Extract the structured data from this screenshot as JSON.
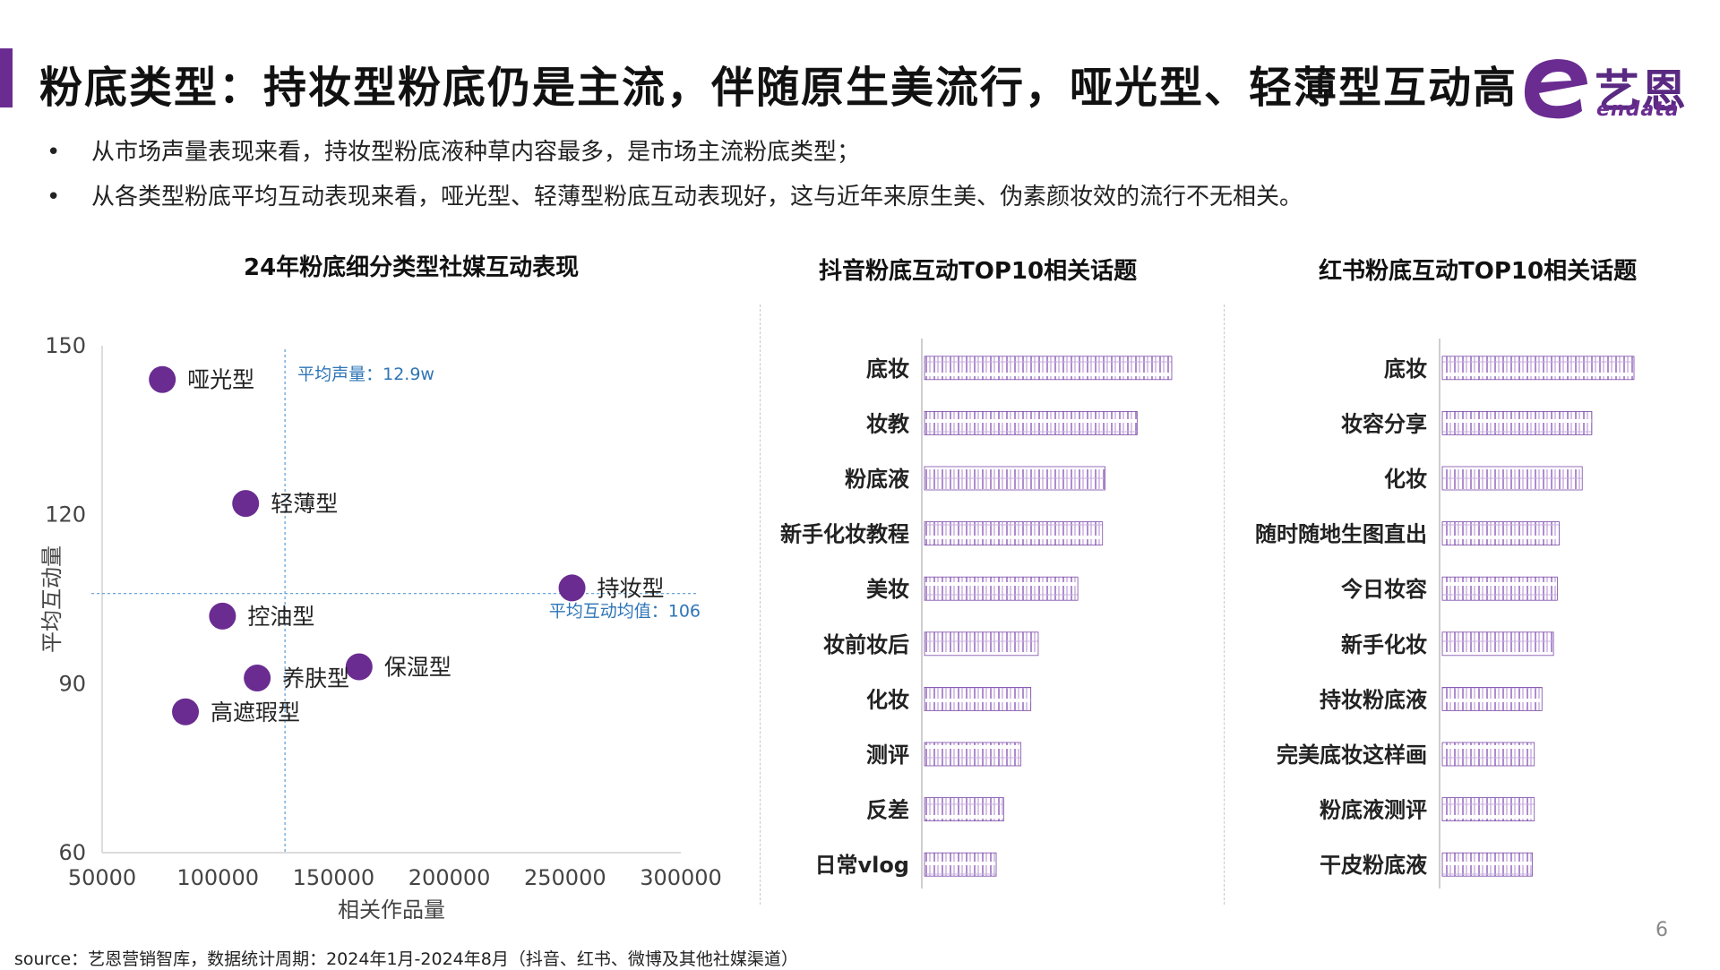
{
  "header": {
    "title": "粉底类型：持妆型粉底仍是主流，伴随原生美流行，哑光型、轻薄型互动高",
    "logo_cn": "艺恩",
    "logo_en": "endata"
  },
  "bullets": [
    {
      "marker": "•",
      "text": "从市场声量表现来看，持妆型粉底液种草内容最多，是市场主流粉底类型；"
    },
    {
      "marker": "•",
      "text": "从各类型粉底平均互动表现来看，哑光型、轻薄型粉底互动表现好，这与近年来原生美、伪素颜妆效的流行不无相关。"
    }
  ],
  "footer": {
    "source": "source：艺恩营销智库，数据统计周期：2024年1月-2024年8月（抖音、红书、微博及其他社媒渠道）",
    "page": "6"
  },
  "colors": {
    "accent": "#6a2c91",
    "point": "#6a2c91",
    "guide": "#5b9bd5",
    "guide_text": "#2e75b6",
    "bar_stroke": "#7a4aa6"
  },
  "chart_data": [
    {
      "type": "scatter",
      "title": "24年粉底细分类型社媒互动表现",
      "xlabel": "相关作品量",
      "ylabel": "平均互动量",
      "xlim": [
        50000,
        300000
      ],
      "ylim": [
        60,
        150
      ],
      "xticks": [
        "50000",
        "100000",
        "150000",
        "200000",
        "250000",
        "300000"
      ],
      "yticks": [
        "60",
        "90",
        "120",
        "150"
      ],
      "points": [
        {
          "label": "哑光型",
          "x": 76000,
          "y": 144
        },
        {
          "label": "轻薄型",
          "x": 112000,
          "y": 122
        },
        {
          "label": "持妆型",
          "x": 253000,
          "y": 107
        },
        {
          "label": "控油型",
          "x": 102000,
          "y": 102
        },
        {
          "label": "保湿型",
          "x": 161000,
          "y": 93
        },
        {
          "label": "养肤型",
          "x": 117000,
          "y": 91
        },
        {
          "label": "高遮瑕型",
          "x": 86000,
          "y": 85
        }
      ],
      "vline": {
        "x": 129000,
        "label": "平均声量：12.9w"
      },
      "hline": {
        "y": 106,
        "label": "平均互动均值：106"
      }
    },
    {
      "type": "bar",
      "title": "抖音粉底互动TOP10相关话题",
      "categories": [
        "底妆",
        "妆教",
        "粉底液",
        "新手化妆教程",
        "美妆",
        "妆前妆后",
        "化妆",
        "测评",
        "反差",
        "日常vlog"
      ],
      "values": [
        100,
        86,
        73,
        72,
        62,
        46,
        43,
        39,
        32,
        29
      ]
    },
    {
      "type": "bar",
      "title": "红书粉底互动TOP10相关话题",
      "categories": [
        "底妆",
        "妆容分享",
        "化妆",
        "随时随地生图直出",
        "今日妆容",
        "新手化妆",
        "持妆粉底液",
        "完美底妆这样画",
        "粉底液测评",
        "干皮粉底液"
      ],
      "values": [
        100,
        78,
        73,
        61,
        60,
        58,
        52,
        48,
        48,
        47
      ]
    }
  ]
}
